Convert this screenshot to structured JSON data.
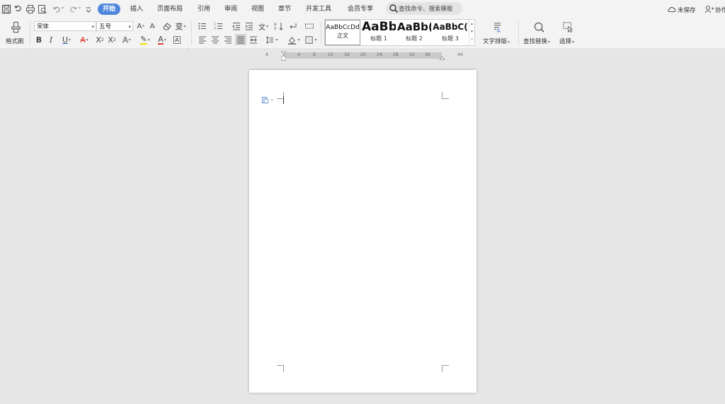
{
  "quick_access": {
    "icons": [
      "save-icon",
      "redo-history-icon",
      "print-icon",
      "print-preview-icon",
      "undo-icon",
      "redo-icon",
      "customize-icon"
    ]
  },
  "tabs": [
    {
      "label": "开始",
      "active": true
    },
    {
      "label": "插入"
    },
    {
      "label": "页面布局"
    },
    {
      "label": "引用"
    },
    {
      "label": "审阅"
    },
    {
      "label": "视图"
    },
    {
      "label": "章节"
    },
    {
      "label": "开发工具"
    },
    {
      "label": "会员专享"
    }
  ],
  "search": {
    "placeholder": "查找命令、搜索模板"
  },
  "status": {
    "unsaved": "未保存",
    "collab": "协作"
  },
  "ribbon": {
    "format_painter": "格式刷",
    "font_name": "宋体",
    "font_size": "五号",
    "styles": [
      {
        "preview": "AaBbCcDd",
        "label": "正文"
      },
      {
        "preview": "AaBb",
        "label": "标题 1"
      },
      {
        "preview": "AaBb(",
        "label": "标题 2"
      },
      {
        "preview": "AaBbC(",
        "label": "标题 3"
      }
    ],
    "text_layout": "文字排版",
    "find_replace": "查找替换",
    "select": "选择"
  },
  "ruler": {
    "ticks": [
      "4",
      "4",
      "8",
      "12",
      "16",
      "20",
      "24",
      "28",
      "32",
      "36",
      "44"
    ]
  },
  "colors": {
    "accent": "#4e86dc",
    "ribbon_bg": "#f3f3f3",
    "workspace": "#e6e6e6",
    "font_color_red": "#e03c31",
    "underline_blue": "#2f5fd0"
  }
}
